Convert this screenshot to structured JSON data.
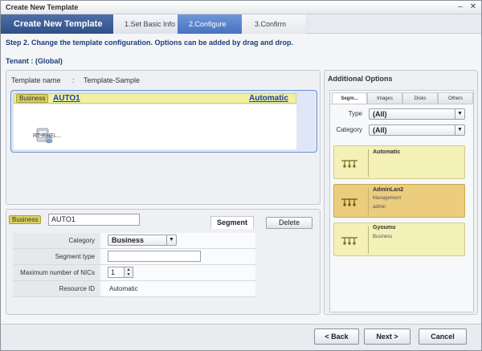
{
  "window": {
    "title": "Create New Template"
  },
  "wizard": {
    "main_label": "Create New Template",
    "steps": [
      {
        "label": "1.Set Basic Info"
      },
      {
        "label": "2.Configure"
      },
      {
        "label": "3.Confirm"
      }
    ]
  },
  "instruction": "Step 2. Change the template configuration.  Options can be added by drag and drop.",
  "tenant": "Tenant : (Global)",
  "template": {
    "name_label": "Template name",
    "separator": ":",
    "name_value": "Template-Sample",
    "segment": {
      "badge": "Business",
      "name": "AUTO1",
      "mode": "Automatic"
    },
    "server": {
      "label": "RT-RHEL..."
    }
  },
  "segment_editor": {
    "badge": "Business",
    "name_value": "AUTO1",
    "tab_label": "Segment",
    "delete_label": "Delete",
    "properties": {
      "category_label": "Category",
      "category_value": "Business",
      "segment_type_label": "Segment type",
      "segment_type_value": "",
      "max_nics_label": "Maximum number of NICs",
      "max_nics_value": "1",
      "resource_id_label": "Resource ID",
      "resource_id_value": "Automatic"
    }
  },
  "additional_options": {
    "title": "Additional Options",
    "tabs": [
      "Segm...",
      "Images",
      "Disks",
      "Others"
    ],
    "type_label": "Type",
    "type_value": "(All)",
    "category_label": "Category",
    "category_value": "(All)",
    "options": [
      {
        "name": "Automatic",
        "sub1": "",
        "sub2": ""
      },
      {
        "name": "AdminLan2",
        "sub1": "Management",
        "sub2": "admin"
      },
      {
        "name": "Gyoumu",
        "sub1": "Business",
        "sub2": ""
      }
    ]
  },
  "footer": {
    "back_label": "< Back",
    "next_label": "Next >",
    "cancel_label": "Cancel"
  },
  "colors": {
    "wizard_active": "#2f4f8a",
    "step_current": "#4772c0",
    "segment_header": "#f0f0a0",
    "option_card": "#f3f0b8",
    "option_card_selected": "#eccd7d",
    "link": "#1a3fa0"
  }
}
